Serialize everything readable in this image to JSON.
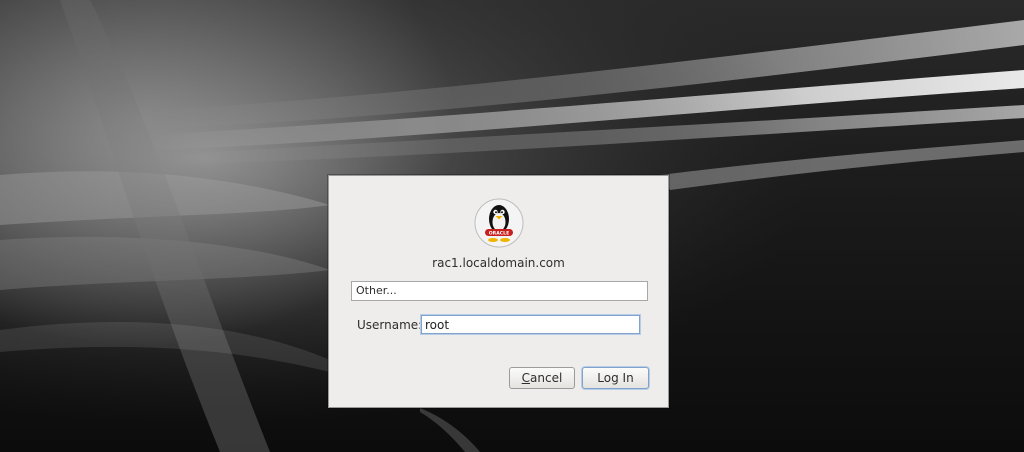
{
  "dialog": {
    "logo_text": "ORACLE",
    "hostname": "rac1.localdomain.com",
    "user_list_selected": "Other...",
    "username_label": "Username:",
    "username_value": "root",
    "cancel_mnemonic": "C",
    "cancel_rest": "ancel",
    "login_label": "Log In"
  },
  "icons": {
    "logo": "oracle-linux-penguin-icon"
  },
  "colors": {
    "dialog_background": "#eeedeb",
    "focus_border": "#7fa3cc",
    "logo_badge": "#c8201f"
  }
}
